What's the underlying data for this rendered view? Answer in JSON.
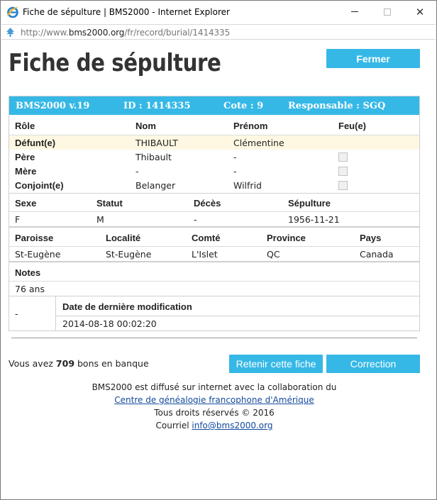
{
  "window": {
    "title": "Fiche de sépulture | BMS2000 - Internet Explorer",
    "address_prefix": "http://www.",
    "address_domain": "bms2000.org",
    "address_path": "/fr/record/burial/1414335"
  },
  "page": {
    "title": "Fiche de sépulture",
    "close_label": "Fermer"
  },
  "record": {
    "header": {
      "version": "BMS2000 v.19",
      "id": "ID : 1414335",
      "cote": "Cote : 9",
      "responsable": "Responsable : SGQ"
    },
    "persons_headers": [
      "Rôle",
      "Nom",
      "Prénom",
      "Feu(e)"
    ],
    "persons": [
      {
        "role": "Défunt(e)",
        "nom": "THIBAULT",
        "prenom": "Clémentine",
        "feu": null
      },
      {
        "role": "Père",
        "nom": "Thibault",
        "prenom": "-",
        "feu": false
      },
      {
        "role": "Mère",
        "nom": "-",
        "prenom": "-",
        "feu": false
      },
      {
        "role": "Conjoint(e)",
        "nom": "Belanger",
        "prenom": "Wilfrid",
        "feu": false
      }
    ],
    "details_headers": [
      "Sexe",
      "Statut",
      "Décès",
      "Sépulture"
    ],
    "details": [
      "F",
      "M",
      "-",
      "1956-11-21"
    ],
    "place_headers": [
      "Paroisse",
      "Localité",
      "Comté",
      "Province",
      "Pays"
    ],
    "place": [
      "St-Eugène",
      "St-Eugène",
      "L'Islet",
      "QC",
      "Canada"
    ],
    "notes_label": "Notes",
    "notes": "76 ans",
    "meta_left": "-",
    "modified_label": "Date de dernière modification",
    "modified": "2014-08-18 00:02:20"
  },
  "bank": {
    "prefix": "Vous avez ",
    "count": "709",
    "suffix": " bons en banque"
  },
  "actions": {
    "retain_label": "Retenir cette fiche",
    "correction_label": "Correction"
  },
  "footer": {
    "line1": "BMS2000 est diffusé sur internet avec la collaboration du",
    "link": "Centre de généalogie francophone d'Amérique",
    "rights": "Tous droits réservés © 2016",
    "mail_prefix": "Courriel ",
    "mail": "info@bms2000.org"
  }
}
